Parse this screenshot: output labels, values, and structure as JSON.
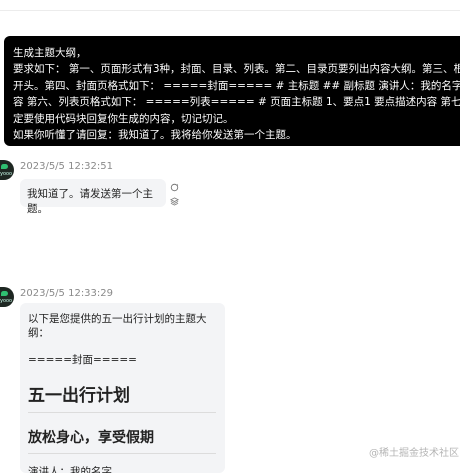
{
  "user_message": {
    "lines": [
      "生成主题大纲，",
      "要求如下： 第一、页面形式有3种，封面、目录、列表。第二、目录页要列出内容大纲。第三、根据内容大纲",
      "开头。第四、封面页格式如下： =====封面===== # 主标题 ## 副标题 演讲人：我的名字 第五、目录页",
      "容 第六、列表页格式如下： =====列表===== # 页面主标题 1、要点1 要点描述内容 第七、列表页里的要",
      "定要使用代码块回复你生成的内容，切记切记。",
      "如果你听懂了请回复：我知道了。我将给你发送第一个主题。"
    ]
  },
  "reply1": {
    "avatar_label": "yooo",
    "timestamp": "2023/5/5 12:32:51",
    "text": "我知道了。请发送第一个主题。"
  },
  "reply2": {
    "avatar_label": "yooo",
    "timestamp": "2023/5/5 12:33:29",
    "intro": "以下是您提供的五一出行计划的主题大纲：",
    "section": "=====封面=====",
    "title": "五一出行计划",
    "subtitle": "放松身心，享受假期",
    "presenter": "演讲人：我的名字"
  },
  "watermark": "@稀土掘金技术社区"
}
